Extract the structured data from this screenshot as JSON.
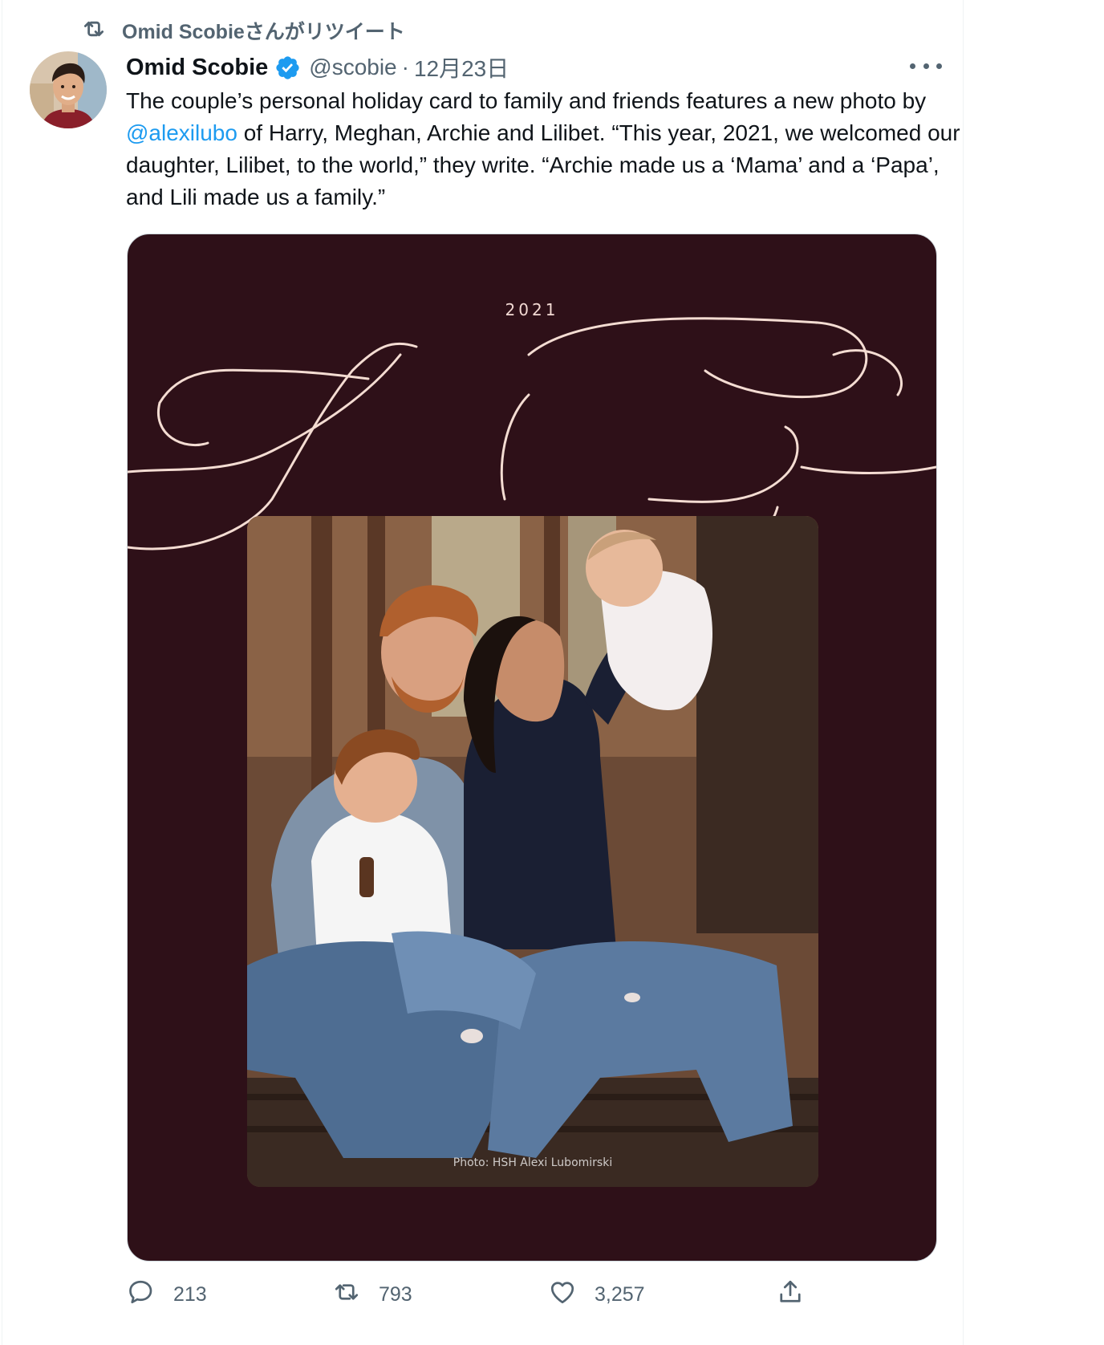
{
  "retweet": {
    "icon": "retweet-icon",
    "label": "Omid Scobieさんがリツイート"
  },
  "tweet": {
    "author_name": "Omid Scobie",
    "verified_icon": "verified-badge-icon",
    "handle": "@scobie",
    "separator": "·",
    "date": "12月23日",
    "text_part1": "The couple’s personal holiday card to family and friends features a new photo by ",
    "mention": "@alexilubo",
    "text_part2": " of Harry, Meghan, Archie and Lilibet. “This year, 2021, we welcomed our daughter, Lilibet, to the world,” they write. “Archie made us a ‘Mama’ and a ‘Papa’, and Lili made us a family.”"
  },
  "media": {
    "year": "2021",
    "script_title": "Happy Holidays",
    "photo_credit": "Photo: HSH Alexi Lubomirski",
    "background_color": "#2e1018"
  },
  "actions": {
    "reply_count": "213",
    "retweet_count": "793",
    "like_count": "3,257",
    "reply_icon": "reply-icon",
    "retweet_icon": "retweet-icon",
    "like_icon": "heart-icon",
    "share_icon": "share-icon"
  },
  "colors": {
    "accent": "#1d9bf0",
    "secondary_text": "#536471",
    "primary_text": "#0f1419"
  }
}
